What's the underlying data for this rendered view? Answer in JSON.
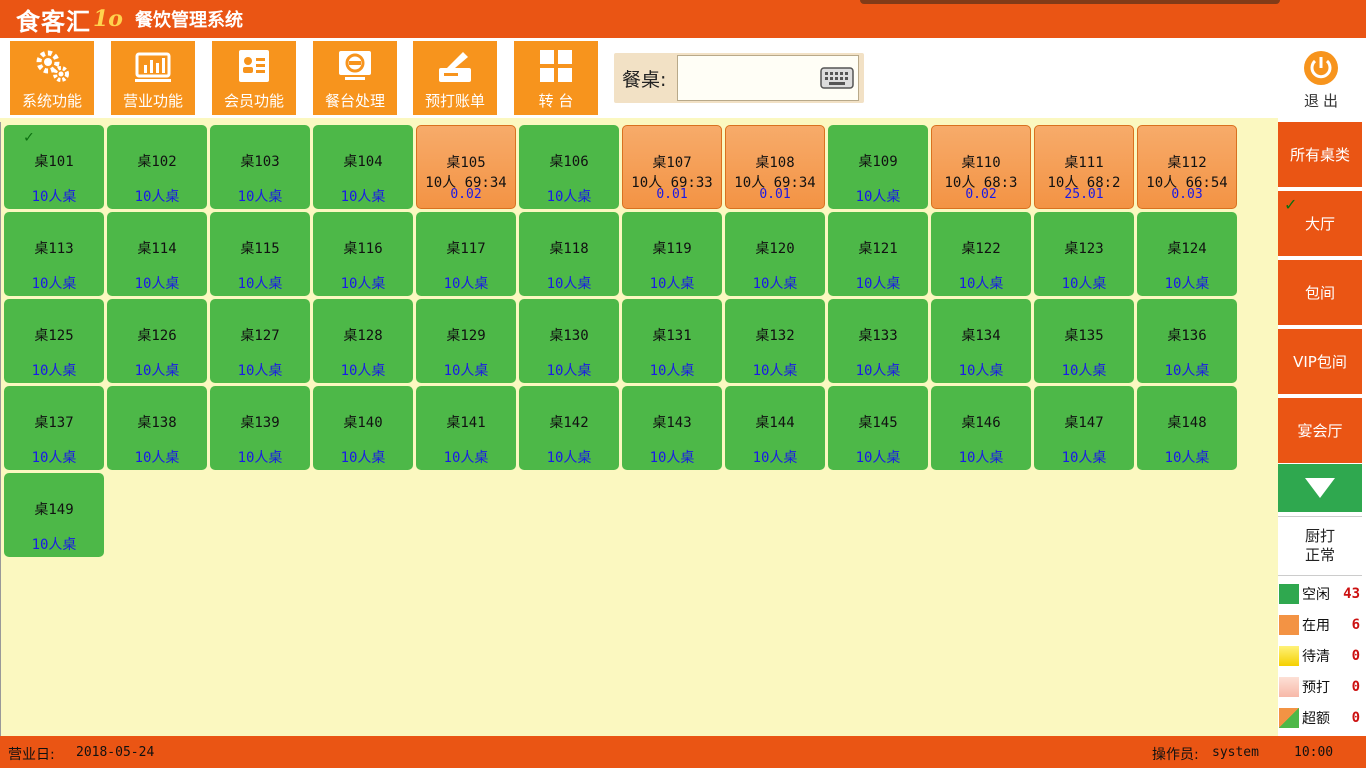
{
  "header": {
    "brand": "食客汇",
    "brand_mark": "1o",
    "app_title": "餐饮管理系统"
  },
  "toolbar": {
    "buttons": [
      {
        "label": "系统功能",
        "icon": "gear-icon"
      },
      {
        "label": "营业功能",
        "icon": "chart-icon"
      },
      {
        "label": "会员功能",
        "icon": "member-card-icon"
      },
      {
        "label": "餐台处理",
        "icon": "table-process-icon"
      },
      {
        "label": "预打账单",
        "icon": "print-bill-icon"
      },
      {
        "label": "转 台",
        "icon": "grid-icon"
      }
    ],
    "search_label": "餐桌:",
    "search_value": "",
    "exit_label": "退出"
  },
  "tables": [
    {
      "name": "桌101",
      "status": "free",
      "capacity": "10人桌",
      "selected": true
    },
    {
      "name": "桌102",
      "status": "free",
      "capacity": "10人桌"
    },
    {
      "name": "桌103",
      "status": "free",
      "capacity": "10人桌"
    },
    {
      "name": "桌104",
      "status": "free",
      "capacity": "10人桌"
    },
    {
      "name": "桌105",
      "status": "busy",
      "info": "10人 69:34",
      "amount": "0.02"
    },
    {
      "name": "桌106",
      "status": "free",
      "capacity": "10人桌"
    },
    {
      "name": "桌107",
      "status": "busy",
      "info": "10人 69:33",
      "amount": "0.01"
    },
    {
      "name": "桌108",
      "status": "busy",
      "info": "10人 69:34",
      "amount": "0.01"
    },
    {
      "name": "桌109",
      "status": "free",
      "capacity": "10人桌"
    },
    {
      "name": "桌110",
      "status": "busy",
      "info": "10人 68:3",
      "amount": "0.02"
    },
    {
      "name": "桌111",
      "status": "busy",
      "info": "10人 68:2",
      "amount": "25.01"
    },
    {
      "name": "桌112",
      "status": "busy",
      "info": "10人 66:54",
      "amount": "0.03"
    },
    {
      "name": "桌113",
      "status": "free",
      "capacity": "10人桌"
    },
    {
      "name": "桌114",
      "status": "free",
      "capacity": "10人桌"
    },
    {
      "name": "桌115",
      "status": "free",
      "capacity": "10人桌"
    },
    {
      "name": "桌116",
      "status": "free",
      "capacity": "10人桌"
    },
    {
      "name": "桌117",
      "status": "free",
      "capacity": "10人桌"
    },
    {
      "name": "桌118",
      "status": "free",
      "capacity": "10人桌"
    },
    {
      "name": "桌119",
      "status": "free",
      "capacity": "10人桌"
    },
    {
      "name": "桌120",
      "status": "free",
      "capacity": "10人桌"
    },
    {
      "name": "桌121",
      "status": "free",
      "capacity": "10人桌"
    },
    {
      "name": "桌122",
      "status": "free",
      "capacity": "10人桌"
    },
    {
      "name": "桌123",
      "status": "free",
      "capacity": "10人桌"
    },
    {
      "name": "桌124",
      "status": "free",
      "capacity": "10人桌"
    },
    {
      "name": "桌125",
      "status": "free",
      "capacity": "10人桌"
    },
    {
      "name": "桌126",
      "status": "free",
      "capacity": "10人桌"
    },
    {
      "name": "桌127",
      "status": "free",
      "capacity": "10人桌"
    },
    {
      "name": "桌128",
      "status": "free",
      "capacity": "10人桌"
    },
    {
      "name": "桌129",
      "status": "free",
      "capacity": "10人桌"
    },
    {
      "name": "桌130",
      "status": "free",
      "capacity": "10人桌"
    },
    {
      "name": "桌131",
      "status": "free",
      "capacity": "10人桌"
    },
    {
      "name": "桌132",
      "status": "free",
      "capacity": "10人桌"
    },
    {
      "name": "桌133",
      "status": "free",
      "capacity": "10人桌"
    },
    {
      "name": "桌134",
      "status": "free",
      "capacity": "10人桌"
    },
    {
      "name": "桌135",
      "status": "free",
      "capacity": "10人桌"
    },
    {
      "name": "桌136",
      "status": "free",
      "capacity": "10人桌"
    },
    {
      "name": "桌137",
      "status": "free",
      "capacity": "10人桌"
    },
    {
      "name": "桌138",
      "status": "free",
      "capacity": "10人桌"
    },
    {
      "name": "桌139",
      "status": "free",
      "capacity": "10人桌"
    },
    {
      "name": "桌140",
      "status": "free",
      "capacity": "10人桌"
    },
    {
      "name": "桌141",
      "status": "free",
      "capacity": "10人桌"
    },
    {
      "name": "桌142",
      "status": "free",
      "capacity": "10人桌"
    },
    {
      "name": "桌143",
      "status": "free",
      "capacity": "10人桌"
    },
    {
      "name": "桌144",
      "status": "free",
      "capacity": "10人桌"
    },
    {
      "name": "桌145",
      "status": "free",
      "capacity": "10人桌"
    },
    {
      "name": "桌146",
      "status": "free",
      "capacity": "10人桌"
    },
    {
      "name": "桌147",
      "status": "free",
      "capacity": "10人桌"
    },
    {
      "name": "桌148",
      "status": "free",
      "capacity": "10人桌"
    },
    {
      "name": "桌149",
      "status": "free",
      "capacity": "10人桌"
    }
  ],
  "sidebar": {
    "categories": [
      {
        "label": "所有桌类",
        "selected": false
      },
      {
        "label": "大厅",
        "selected": true
      },
      {
        "label": "包间",
        "selected": false
      },
      {
        "label": "VIP包间",
        "selected": false
      },
      {
        "label": "宴会厅",
        "selected": false
      }
    ],
    "down_icon": "chevron-down-icon",
    "kitchen_line1": "厨打",
    "kitchen_line2": "正常",
    "legend": [
      {
        "label": "空闲",
        "count": "43",
        "color": "#2fa84f"
      },
      {
        "label": "在用",
        "count": "6",
        "color": "#f39344"
      },
      {
        "label": "待清",
        "count": "0",
        "color": "#f5d000"
      },
      {
        "label": "预打",
        "count": "0",
        "color": "#f7b8a8"
      },
      {
        "label": "超额",
        "count": "0",
        "color": "#f39344"
      }
    ]
  },
  "statusbar": {
    "business_day_label": "营业日:",
    "business_day": "2018-05-24",
    "operator_label": "操作员:",
    "operator": "system",
    "time": "10:00"
  },
  "colors": {
    "brand_orange": "#ea5514",
    "tool_orange": "#f7941d",
    "free_green": "#4db848",
    "busy_orange": "#f39344",
    "grid_bg": "#fbf8c0"
  }
}
